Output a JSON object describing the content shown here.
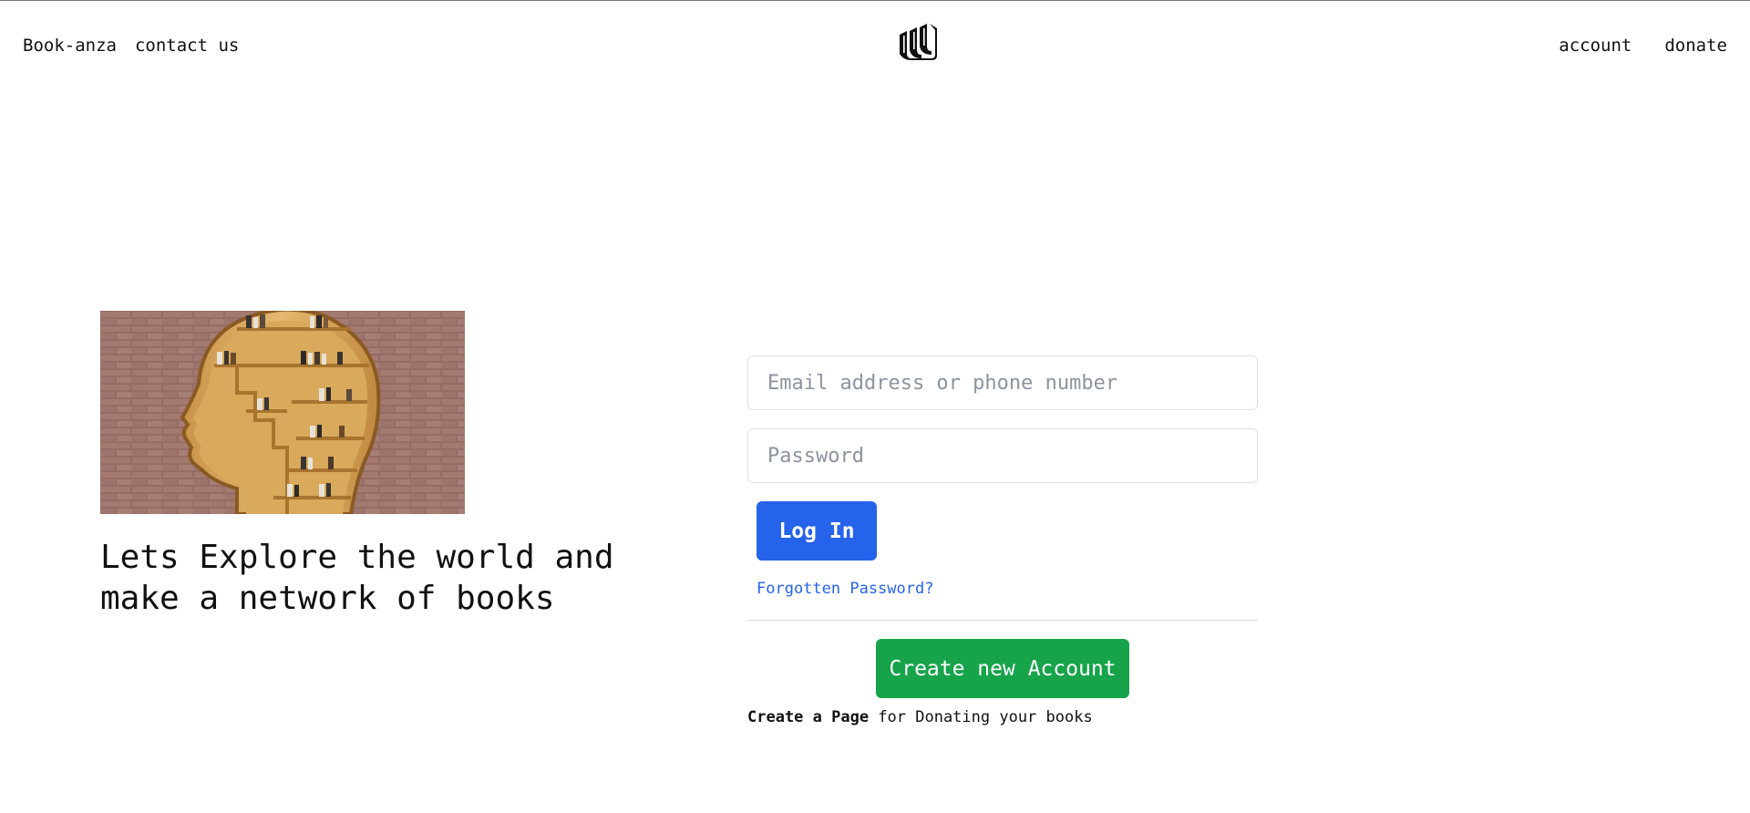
{
  "nav": {
    "left": [
      "Book-anza",
      "contact us"
    ],
    "right": [
      "account",
      "donate"
    ],
    "logo_icon": "stacked-books-logo"
  },
  "hero": {
    "image_icon": "head-bookshelf-illustration",
    "tagline": "Lets Explore the world and make a network of books"
  },
  "login": {
    "email_placeholder": "Email address or phone number",
    "password_placeholder": "Password",
    "login_label": "Log In",
    "forgot_label": "Forgotten Password?",
    "create_label": "Create new Account",
    "page_link": "Create a Page",
    "page_suffix": " for Donating your books"
  },
  "colors": {
    "primary": "#2563eb",
    "success": "#16a34a",
    "text": "#111111"
  }
}
